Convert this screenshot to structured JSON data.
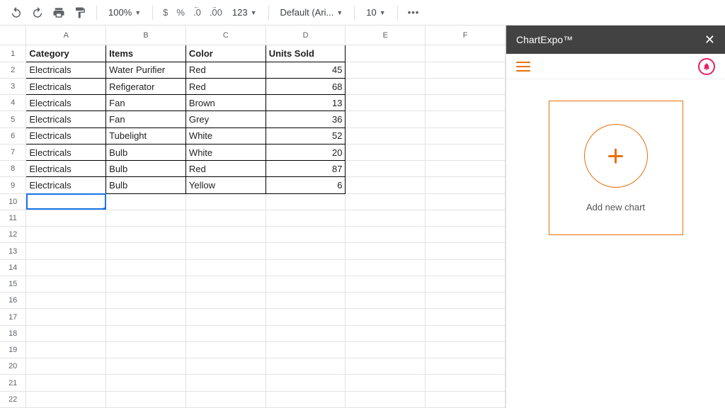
{
  "toolbar": {
    "zoom": "100%",
    "currency": "$",
    "percent": "%",
    "dec_less": ".0",
    "dec_more": ".00",
    "num_fmt": "123",
    "font": "Default (Ari...",
    "font_size": "10",
    "more": "•••"
  },
  "sheet": {
    "columns": [
      "A",
      "B",
      "C",
      "D",
      "E",
      "F"
    ],
    "headers": [
      "Category",
      "Items",
      "Color",
      "Units Sold"
    ],
    "rows": [
      [
        "Electricals",
        "Water Purifier",
        "Red",
        "45"
      ],
      [
        "Electricals",
        "Refigerator",
        "Red",
        "68"
      ],
      [
        "Electricals",
        "Fan",
        "Brown",
        "13"
      ],
      [
        "Electricals",
        "Fan",
        "Grey",
        "36"
      ],
      [
        "Electricals",
        "Tubelight",
        "White",
        "52"
      ],
      [
        "Electricals",
        "Bulb",
        "White",
        "20"
      ],
      [
        "Electricals",
        "Bulb",
        "Red",
        "87"
      ],
      [
        "Electricals",
        "Bulb",
        "Yellow",
        "6"
      ]
    ],
    "total_rows": 22,
    "selected_cell": "A10"
  },
  "sidepanel": {
    "title": "ChartExpo™",
    "add_new": "Add new chart"
  },
  "chart_data": {
    "type": "table",
    "columns": [
      "Category",
      "Items",
      "Color",
      "Units Sold"
    ],
    "rows": [
      [
        "Electricals",
        "Water Purifier",
        "Red",
        45
      ],
      [
        "Electricals",
        "Refigerator",
        "Red",
        68
      ],
      [
        "Electricals",
        "Fan",
        "Brown",
        13
      ],
      [
        "Electricals",
        "Fan",
        "Grey",
        36
      ],
      [
        "Electricals",
        "Tubelight",
        "White",
        52
      ],
      [
        "Electricals",
        "Bulb",
        "White",
        20
      ],
      [
        "Electricals",
        "Bulb",
        "Red",
        87
      ],
      [
        "Electricals",
        "Bulb",
        "Yellow",
        6
      ]
    ]
  }
}
